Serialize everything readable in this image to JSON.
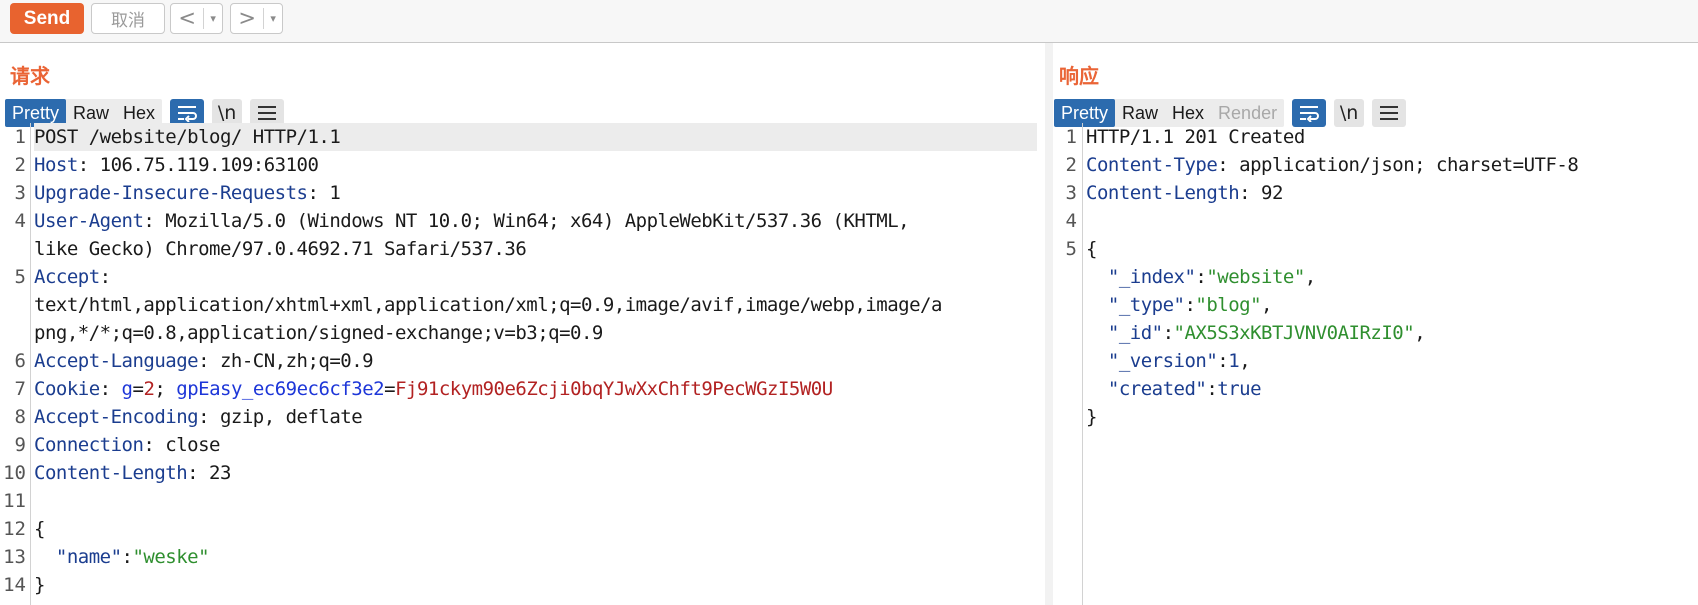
{
  "toolbar": {
    "send_label": "Send",
    "cancel_label": "取消",
    "back_arrow": "<",
    "forward_arrow": ">",
    "dropdown_glyph": "▾"
  },
  "request": {
    "title": "请求",
    "tabs": [
      "Pretty",
      "Raw",
      "Hex"
    ],
    "newline_label": "\\n",
    "lines": [
      {
        "n": "1",
        "parts": [
          {
            "t": "POST /website/blog/ HTTP/1.1",
            "c": "v"
          }
        ]
      },
      {
        "n": "2",
        "parts": [
          {
            "t": "Host",
            "c": "k"
          },
          {
            "t": ": 106.75.119.109:63100",
            "c": "v"
          }
        ]
      },
      {
        "n": "3",
        "parts": [
          {
            "t": "Upgrade-Insecure-Requests",
            "c": "k"
          },
          {
            "t": ": 1",
            "c": "v"
          }
        ]
      },
      {
        "n": "4",
        "parts": [
          {
            "t": "User-Agent",
            "c": "k"
          },
          {
            "t": ": Mozilla/5.0 (Windows NT 10.0; Win64; x64) AppleWebKit/537.36 (KHTML,",
            "c": "v"
          }
        ]
      },
      {
        "n": "",
        "parts": [
          {
            "t": "like Gecko) Chrome/97.0.4692.71 Safari/537.36",
            "c": "v"
          }
        ]
      },
      {
        "n": "5",
        "parts": [
          {
            "t": "Accept",
            "c": "k"
          },
          {
            "t": ":",
            "c": "v"
          }
        ]
      },
      {
        "n": "",
        "parts": [
          {
            "t": "text/html,application/xhtml+xml,application/xml;q=0.9,image/avif,image/webp,image/a",
            "c": "v"
          }
        ]
      },
      {
        "n": "",
        "parts": [
          {
            "t": "png,*/*;q=0.8,application/signed-exchange;v=b3;q=0.9",
            "c": "v"
          }
        ]
      },
      {
        "n": "6",
        "parts": [
          {
            "t": "Accept-Language",
            "c": "k"
          },
          {
            "t": ": zh-CN,zh;q=0.9",
            "c": "v"
          }
        ]
      },
      {
        "n": "7",
        "parts": [
          {
            "t": "Cookie",
            "c": "k"
          },
          {
            "t": ": ",
            "c": "v"
          },
          {
            "t": "g",
            "c": "ck"
          },
          {
            "t": "=",
            "c": "v"
          },
          {
            "t": "2",
            "c": "cv"
          },
          {
            "t": "; ",
            "c": "v"
          },
          {
            "t": "gpEasy_ec69ec6cf3e2",
            "c": "ck"
          },
          {
            "t": "=",
            "c": "v"
          },
          {
            "t": "Fj91ckym90e6Zcji0bqYJwXxChft9PecWGzI5W0U",
            "c": "cv"
          }
        ]
      },
      {
        "n": "8",
        "parts": [
          {
            "t": "Accept-Encoding",
            "c": "k"
          },
          {
            "t": ": gzip, deflate",
            "c": "v"
          }
        ]
      },
      {
        "n": "9",
        "parts": [
          {
            "t": "Connection",
            "c": "k"
          },
          {
            "t": ": close",
            "c": "v"
          }
        ]
      },
      {
        "n": "10",
        "parts": [
          {
            "t": "Content-Length",
            "c": "k"
          },
          {
            "t": ": 23",
            "c": "v"
          }
        ]
      },
      {
        "n": "11",
        "parts": []
      },
      {
        "n": "12",
        "parts": [
          {
            "t": "{",
            "c": "v"
          }
        ]
      },
      {
        "n": "13",
        "parts": [
          {
            "t": "  \"name\"",
            "c": "js"
          },
          {
            "t": ":",
            "c": "v"
          },
          {
            "t": "\"weske\"",
            "c": "jv"
          }
        ]
      },
      {
        "n": "14",
        "parts": [
          {
            "t": "}",
            "c": "v"
          }
        ]
      }
    ]
  },
  "response": {
    "title": "响应",
    "tabs": [
      "Pretty",
      "Raw",
      "Hex",
      "Render"
    ],
    "newline_label": "\\n",
    "lines": [
      {
        "n": "1",
        "parts": [
          {
            "t": "HTTP/1.1 201 Created",
            "c": "v"
          }
        ]
      },
      {
        "n": "2",
        "parts": [
          {
            "t": "Content-Type",
            "c": "k"
          },
          {
            "t": ": application/json; charset=UTF-8",
            "c": "v"
          }
        ]
      },
      {
        "n": "3",
        "parts": [
          {
            "t": "Content-Length",
            "c": "k"
          },
          {
            "t": ": 92",
            "c": "v"
          }
        ]
      },
      {
        "n": "4",
        "parts": []
      },
      {
        "n": "5",
        "parts": [
          {
            "t": "{",
            "c": "v"
          }
        ]
      },
      {
        "n": "",
        "parts": [
          {
            "t": "  \"_index\"",
            "c": "js"
          },
          {
            "t": ":",
            "c": "v"
          },
          {
            "t": "\"website\"",
            "c": "jv"
          },
          {
            "t": ",",
            "c": "v"
          }
        ]
      },
      {
        "n": "",
        "parts": [
          {
            "t": "  \"_type\"",
            "c": "js"
          },
          {
            "t": ":",
            "c": "v"
          },
          {
            "t": "\"blog\"",
            "c": "jv"
          },
          {
            "t": ",",
            "c": "v"
          }
        ]
      },
      {
        "n": "",
        "parts": [
          {
            "t": "  \"_id\"",
            "c": "js"
          },
          {
            "t": ":",
            "c": "v"
          },
          {
            "t": "\"AX5S3xKBTJVNV0AIRzI0\"",
            "c": "jv"
          },
          {
            "t": ",",
            "c": "v"
          }
        ]
      },
      {
        "n": "",
        "parts": [
          {
            "t": "  \"_version\"",
            "c": "js"
          },
          {
            "t": ":",
            "c": "v"
          },
          {
            "t": "1",
            "c": "js"
          },
          {
            "t": ",",
            "c": "v"
          }
        ]
      },
      {
        "n": "",
        "parts": [
          {
            "t": "  \"created\"",
            "c": "js"
          },
          {
            "t": ":",
            "c": "v"
          },
          {
            "t": "true",
            "c": "js"
          }
        ]
      },
      {
        "n": "",
        "parts": [
          {
            "t": "}",
            "c": "v"
          }
        ]
      }
    ]
  },
  "colors": {
    "accent": "#e8632f",
    "tab_active": "#2c6bae",
    "header_key": "#1b3d8f",
    "cookie_name": "#1d36d8",
    "cookie_value": "#b22222",
    "json_string": "#2f8f2f"
  }
}
